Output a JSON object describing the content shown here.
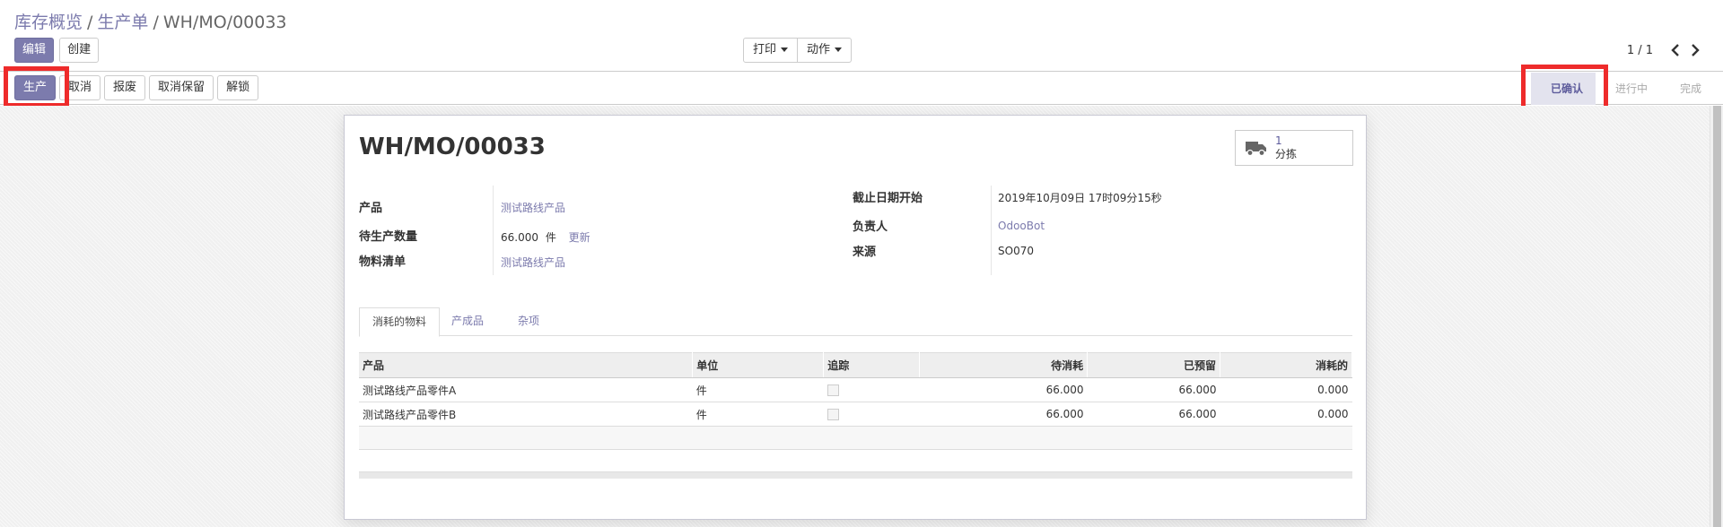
{
  "breadcrumb": {
    "item1": "库存概览",
    "item2": "生产单",
    "current": "WH/MO/00033",
    "separator": "/"
  },
  "control": {
    "edit_label": "编辑",
    "create_label": "创建",
    "print_label": "打印",
    "action_label": "动作"
  },
  "pager": {
    "value": "1 / 1"
  },
  "statusbar": {
    "buttons": {
      "produce": "生产",
      "cancel": "取消",
      "scrap": "报废",
      "unreserve": "取消保留",
      "unlock": "解锁"
    },
    "stages": {
      "confirmed": "已确认",
      "progress": "进行中",
      "done": "完成"
    }
  },
  "record": {
    "name": "WH/MO/00033",
    "smart_button": {
      "count": "1",
      "label": "分拣"
    },
    "fields": {
      "product_label": "产品",
      "product_value": "测试路线产品",
      "qty_label": "待生产数量",
      "qty_value": "66.000",
      "qty_uom": "件",
      "qty_update": "更新",
      "bom_label": "物料清单",
      "bom_value": "测试路线产品",
      "deadline_label": "截止日期开始",
      "deadline_value": "2019年10月09日 17时09分15秒",
      "responsible_label": "负责人",
      "responsible_value": "OdooBot",
      "origin_label": "来源",
      "origin_value": "SO070"
    },
    "tabs": {
      "consumed": "消耗的物料",
      "finished": "产成品",
      "misc": "杂项"
    },
    "table": {
      "headers": {
        "product": "产品",
        "uom": "单位",
        "tracking": "追踪",
        "to_consume": "待消耗",
        "reserved": "已预留",
        "consumed": "消耗的"
      },
      "rows": [
        {
          "product": "测试路线产品零件A",
          "uom": "件",
          "to_consume": "66.000",
          "reserved": "66.000",
          "consumed": "0.000"
        },
        {
          "product": "测试路线产品零件B",
          "uom": "件",
          "to_consume": "66.000",
          "reserved": "66.000",
          "consumed": "0.000"
        }
      ]
    }
  },
  "colors": {
    "brand": "#7c7bad",
    "highlight": "#ee2b2b",
    "stage_active_bg": "#e3e3ee"
  },
  "icons": {
    "truck": "truck-icon",
    "prev": "chevron-left-icon",
    "next": "chevron-right-icon",
    "caret": "caret-down-icon"
  }
}
